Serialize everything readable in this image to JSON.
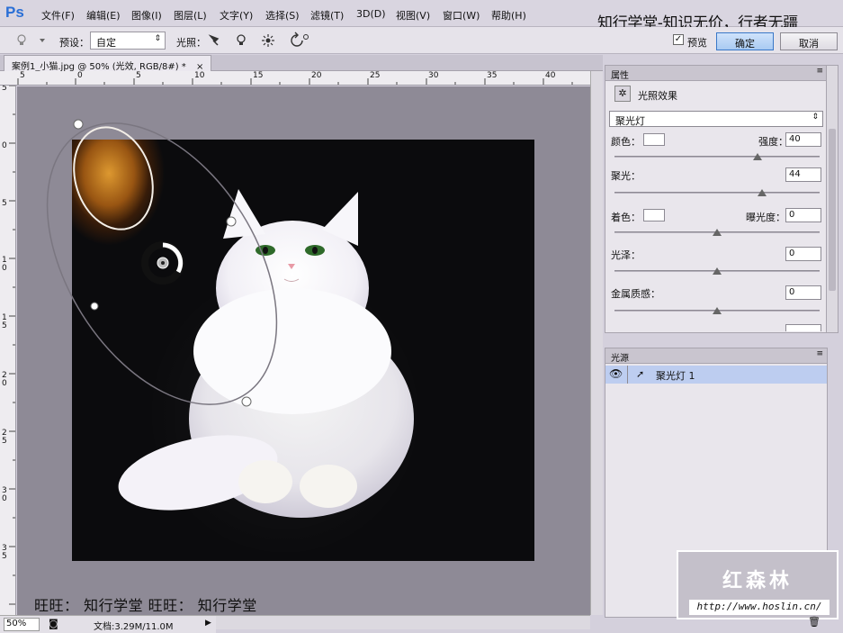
{
  "app": {
    "logo": "Ps"
  },
  "menu": [
    "文件(F)",
    "编辑(E)",
    "图像(I)",
    "图层(L)",
    "文字(Y)",
    "选择(S)",
    "滤镜(T)",
    "3D(D)",
    "视图(V)",
    "窗口(W)",
    "帮助(H)"
  ],
  "watermark_top": "知行学堂-知识无价，行者无疆",
  "options": {
    "preset_label": "预设：",
    "preset_value": "自定",
    "lights_label": "光照：",
    "preview_label": "预览",
    "preview_checked": true,
    "ok_label": "确定",
    "cancel_label": "取消"
  },
  "doc_tab": {
    "title": "案例1_小猫.jpg @ 50% (光效, RGB/8#) *",
    "close": "×"
  },
  "ruler_top": [
    "5",
    "0",
    "5",
    "10",
    "15",
    "20",
    "25",
    "30",
    "35",
    "40"
  ],
  "ruler_left": [
    "5",
    "0",
    "5",
    "1 0",
    "1 5",
    "2 0",
    "2 5",
    "3 0",
    "3 5"
  ],
  "status": {
    "zoom": "50%",
    "doc_info": "文档:3.29M/11.0M"
  },
  "bottom_text": "旺旺： 知行学堂  旺旺： 知行学堂",
  "properties": {
    "panel_title": "属性",
    "effect_title": "光照效果",
    "light_type": "聚光灯",
    "color_label": "颜色：",
    "intensity_label": "强度：",
    "intensity_value": "40",
    "hotspot_label": "聚光：",
    "hotspot_value": "44",
    "colorize_label": "着色：",
    "exposure_label": "曝光度：",
    "exposure_value": "0",
    "gloss_label": "光泽：",
    "gloss_value": "0",
    "metallic_label": "金属质感：",
    "metallic_value": "0"
  },
  "lights_panel": {
    "title": "光源",
    "items": [
      {
        "name": "聚光灯 1"
      }
    ]
  },
  "watermark_box": {
    "title": "红森林",
    "url": "http://www.hoslin.cn/"
  },
  "colors": {
    "accent": "#2a6fd6",
    "selection": "#bdcdf0",
    "canvas_bg": "#8e8a96",
    "light_orange": "#e8a032"
  }
}
